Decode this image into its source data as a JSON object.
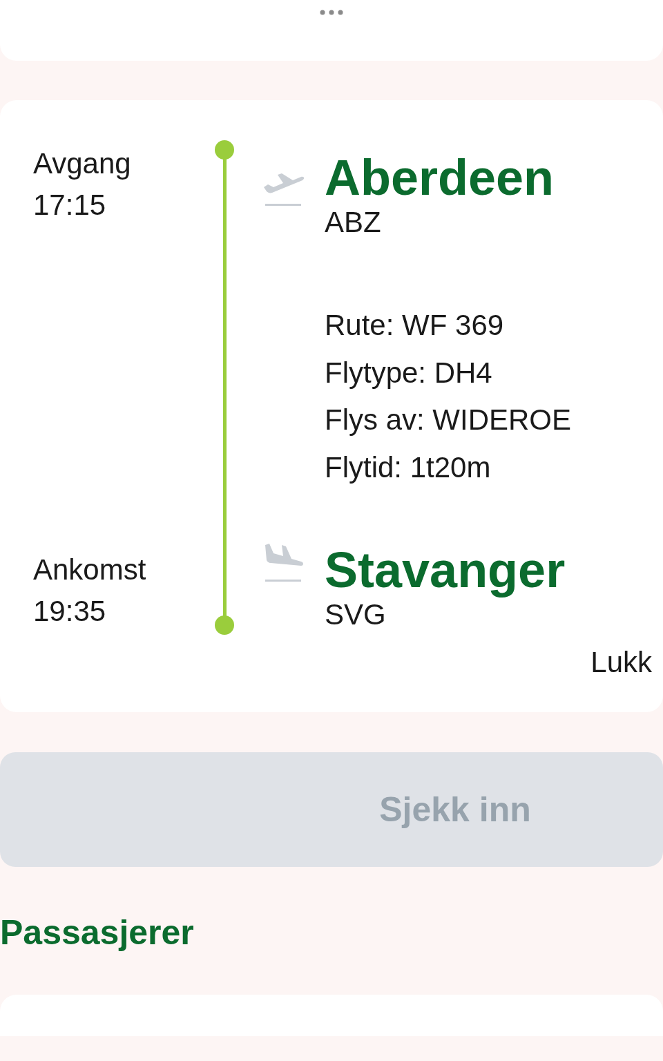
{
  "flight": {
    "departure": {
      "label": "Avgang",
      "time": "17:15",
      "city": "Aberdeen",
      "code": "ABZ"
    },
    "details": [
      "Rute: WF 369",
      "Flytype: DH4",
      "Flys av: WIDEROE",
      "Flytid: 1t20m"
    ],
    "arrival": {
      "label": "Ankomst",
      "time": "19:35",
      "city": "Stavanger",
      "code": "SVG"
    },
    "close_link": "Lukk"
  },
  "check_in_button": {
    "label": "Sjekk inn",
    "disabled": true
  },
  "passengers_heading": "Passasjerer"
}
